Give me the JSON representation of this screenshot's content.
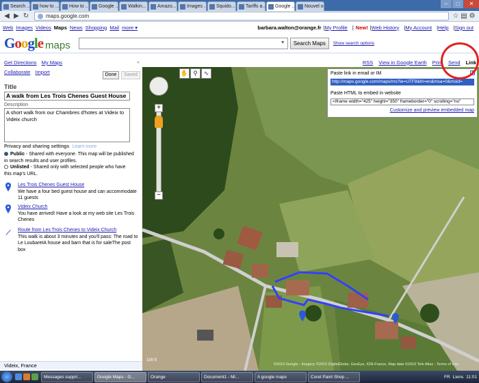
{
  "browser": {
    "tabs": [
      {
        "label": "Search ..."
      },
      {
        "label": "how to ..."
      },
      {
        "label": "How to ..."
      },
      {
        "label": "Google ..."
      },
      {
        "label": "Walkin..."
      },
      {
        "label": "Amazo..."
      },
      {
        "label": "Images ..."
      },
      {
        "label": "Squido..."
      },
      {
        "label": "Tariffs a..."
      },
      {
        "label": "Google ..."
      },
      {
        "label": "Nouvel on..."
      }
    ],
    "url": "maps.google.com"
  },
  "gnav": {
    "items": [
      "Web",
      "Images",
      "Videos",
      "Maps",
      "News",
      "Shopping",
      "Mail",
      "more ▾"
    ],
    "user_email": "barbara.walton@orange.fr",
    "my_profile": "My Profile",
    "new_badge": "New!",
    "web_history": "Web History",
    "my_account": "My Account",
    "help": "Help",
    "sign_out": "Sign out",
    "sep": "|"
  },
  "search": {
    "logo_letters": [
      "G",
      "o",
      "o",
      "g",
      "l",
      "e"
    ],
    "logo_suffix": "maps",
    "button": "Search Maps",
    "options": "Show search options"
  },
  "left": {
    "get_directions": "Get Directions",
    "my_maps": "My Maps",
    "collaborate": "Collaborate",
    "import": "Import",
    "done": "Done",
    "saved": "Saved",
    "title_label": "Title",
    "title_value": "A walk from Les Trois Chenes Guest House",
    "description_label": "Description",
    "description_value": "A short walk from our Chambres d'hotes at Videix to Videix church",
    "privacy_label": "Privacy and sharing settings",
    "learn_more": "Learn more",
    "public_title": "Public",
    "public_desc": " - Shared with everyone. This map will be published in search results and user profiles.",
    "unlisted_title": "Unlisted",
    "unlisted_desc": " - Shared only with selected people who have this map's URL.",
    "places": [
      {
        "name": "Les Trois Chenes Guest House",
        "text": "We have a four bed guest house and can accommodate 11 guests"
      },
      {
        "name": "Videix Church",
        "text": "You have arrived! Have a look at my web site Les Trois Chenes"
      },
      {
        "name": "Route from Les Trois Chenes to Videix Church",
        "text": "This walk is about 3 minutes and you'll pass: The road to Le LoubaretA house and barn that is for saleThe post box"
      }
    ],
    "footer_location": "Videix, France"
  },
  "map_toolbar": {
    "rss": "RSS",
    "google_earth": "View in Google Earth",
    "print": "Print",
    "send": "Send",
    "link": "Link"
  },
  "link_popup": {
    "paste_link_label": "Paste link in email or IM",
    "link_url": "http://maps.google.com/maps/ms?ie=UTF8&hl=en&msa=0&msid=",
    "paste_html_label": "Paste HTML to embed in website",
    "embed_code": "<iframe width=\"425\" height=\"350\" frameborder=\"0\" scrolling=\"no\"",
    "customize": "Customize and preview embedded map"
  },
  "map": {
    "copyright": "©2010 Google - Imagery ©2010 DigitalGlobe, GeoEye, IGN-France, Map data ©2010 Tele Atlas - Terms of Use",
    "scale": "100 ft"
  },
  "taskbar": {
    "tasks": [
      "Messages suppri...",
      "Google Maps - G...",
      "Orange",
      "Document1 - Mi...",
      "A google maps",
      "Corel Paint Shop ..."
    ],
    "lang": "FR",
    "links": "Liens",
    "time": "11:01"
  },
  "colors": {
    "route": "#3340ff",
    "marker": "#2a5ad8",
    "highlight_circle": "#e02020"
  }
}
